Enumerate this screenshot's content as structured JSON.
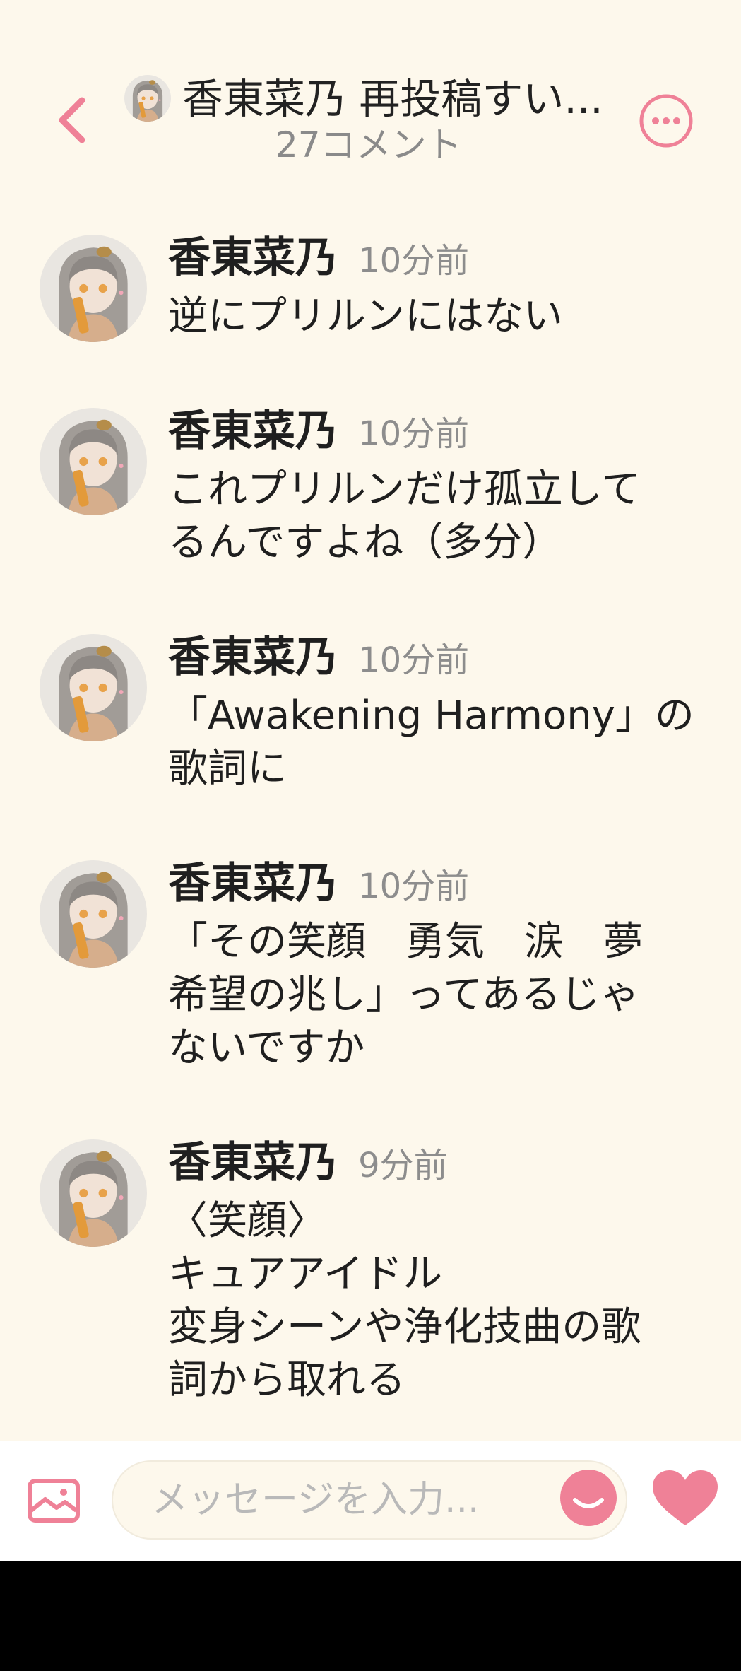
{
  "header": {
    "title": "香東菜乃 再投稿すい...",
    "subtitle": "27コメント"
  },
  "comments": [
    {
      "author": "香東菜乃",
      "time": "10分前",
      "text": "逆にプリルンにはない"
    },
    {
      "author": "香東菜乃",
      "time": "10分前",
      "text": "これプリルンだけ孤立して\nるんですよね（多分）"
    },
    {
      "author": "香東菜乃",
      "time": "10分前",
      "text": "「Awakening Harmony」の\n歌詞に"
    },
    {
      "author": "香東菜乃",
      "time": "10分前",
      "text": "「その笑顔　勇気　涙　夢\n希望の兆し」ってあるじゃ\nないですか"
    },
    {
      "author": "香東菜乃",
      "time": "9分前",
      "text": "〈笑顔〉\nキュアアイドル\n変身シーンや浄化技曲の歌\n詞から取れる"
    }
  ],
  "input": {
    "placeholder": "メッセージを入力..."
  },
  "colors": {
    "background": "#fdf8ec",
    "accent": "#ef8197",
    "muted_text": "#8d8d8d"
  },
  "icons": {
    "back": "chevron-left-icon",
    "more": "more-horizontal-icon",
    "image": "image-icon",
    "emoji": "smile-icon",
    "like": "heart-icon"
  }
}
